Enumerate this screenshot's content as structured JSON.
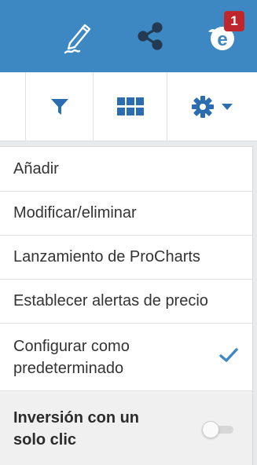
{
  "header": {
    "notification_count": "1",
    "accent_color": "#3d88c3",
    "icons": [
      "pencil-icon",
      "share-icon",
      "profile-icon"
    ]
  },
  "toolbar": {
    "icons": [
      "filter-icon",
      "grid-icon",
      "gear-icon",
      "caret-down-icon"
    ]
  },
  "menu": {
    "items": [
      {
        "label": "Añadir"
      },
      {
        "label": "Modificar/eliminar"
      },
      {
        "label": "Lanzamiento de ProCharts"
      },
      {
        "label": "Establecer alertas de precio"
      },
      {
        "label": "Configurar como predeterminado",
        "checked": true
      }
    ],
    "one_click": {
      "label": "Inversión con un solo clic",
      "enabled": false
    }
  }
}
